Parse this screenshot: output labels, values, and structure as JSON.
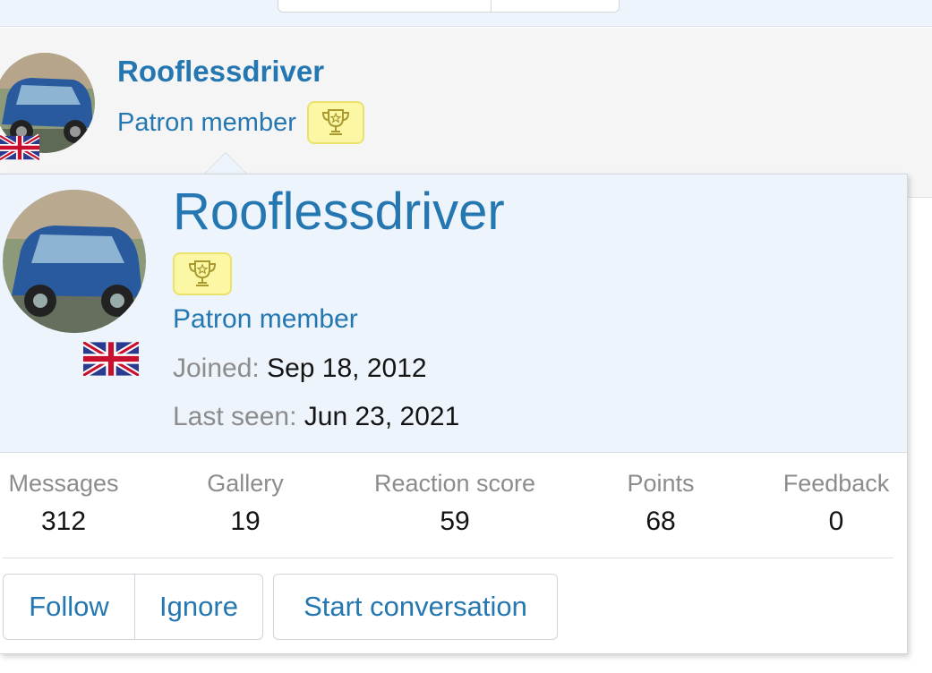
{
  "post": {
    "username": "Rooflessdriver",
    "user_title": "Patron member",
    "badge_icon": "trophy-icon",
    "flag": "uk-flag"
  },
  "member_tooltip": {
    "username": "Rooflessdriver",
    "badge_icon": "trophy-icon",
    "user_title": "Patron member",
    "joined_label": "Joined:",
    "joined_value": "Sep 18, 2012",
    "last_seen_label": "Last seen:",
    "last_seen_value": "Jun 23, 2021",
    "stats": [
      {
        "label": "Messages",
        "value": "312"
      },
      {
        "label": "Gallery",
        "value": "19"
      },
      {
        "label": "Reaction score",
        "value": "59"
      },
      {
        "label": "Points",
        "value": "68"
      },
      {
        "label": "Feedback",
        "value": "0"
      }
    ],
    "buttons": {
      "follow": "Follow",
      "ignore": "Ignore",
      "start_conversation": "Start conversation"
    }
  },
  "colors": {
    "accent": "#2577b1",
    "header_bg": "#edf4fc",
    "badge_bg": "#fbf7a5",
    "muted_text": "#8c8c8c"
  }
}
